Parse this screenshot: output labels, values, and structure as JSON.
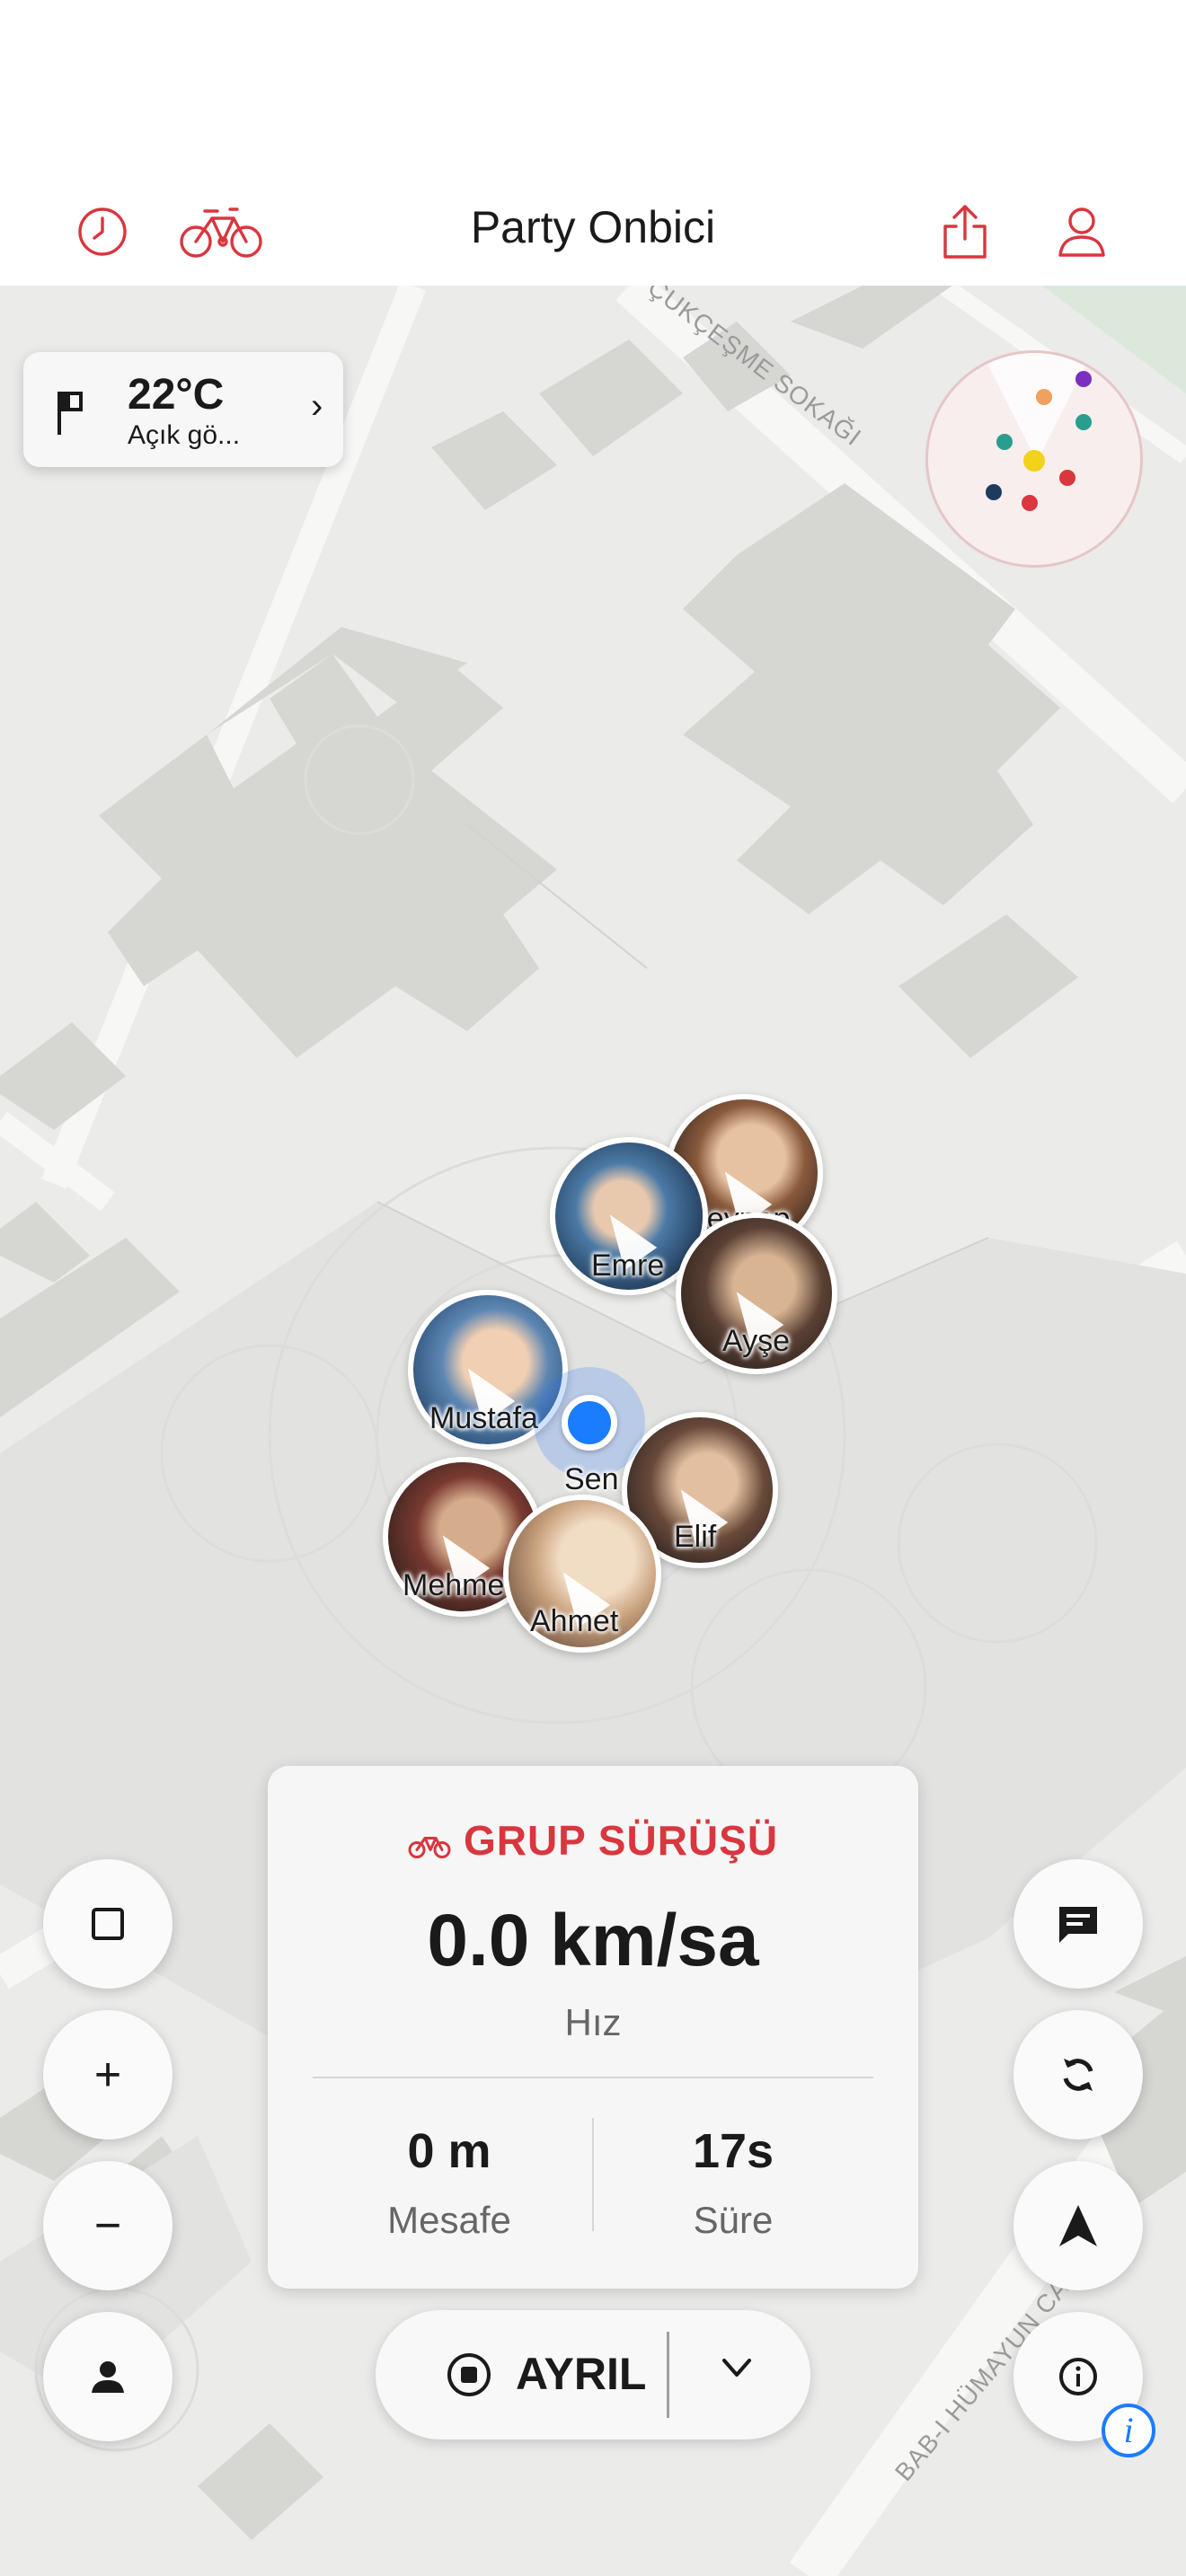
{
  "nav": {
    "title": "Party Onbici",
    "left_icons": [
      "history-icon",
      "bicycle-icon"
    ],
    "right_icons": [
      "share-icon",
      "profile-icon"
    ],
    "accent_color": "#d9363e"
  },
  "map": {
    "street_top": "ÇUKÇEŞME SOKAĞI",
    "street_bottom": "BAB-I HÜMAYUN CADDESİ"
  },
  "weather": {
    "temperature": "22°C",
    "condition": "Açık gö...",
    "chevron": "›"
  },
  "radar": {
    "dot_colors": [
      "#7b2fbf",
      "#f0a060",
      "#2a9d8f",
      "#2a9d8f",
      "#f2d21b",
      "#d9363e",
      "#1f3a5f",
      "#d9363e"
    ]
  },
  "riders": [
    {
      "name": "Zeynep"
    },
    {
      "name": "Emre"
    },
    {
      "name": "Ayşe"
    },
    {
      "name": "Mustafa"
    },
    {
      "name": "Elif"
    },
    {
      "name": "Mehmet"
    },
    {
      "name": "Ahmet"
    }
  ],
  "self": {
    "label": "Sen",
    "color": "#1a7cff"
  },
  "stats": {
    "header": "GRUP SÜRÜŞÜ",
    "speed": "0.0 km/sa",
    "speed_label": "Hız",
    "distance_value": "0 m",
    "distance_label": "Mesafe",
    "duration_value": "17s",
    "duration_label": "Süre"
  },
  "left_controls": {
    "square": "□",
    "zoom_in": "+",
    "zoom_out": "−"
  },
  "leave": {
    "label": "AYRIL"
  },
  "info_badge": "i"
}
